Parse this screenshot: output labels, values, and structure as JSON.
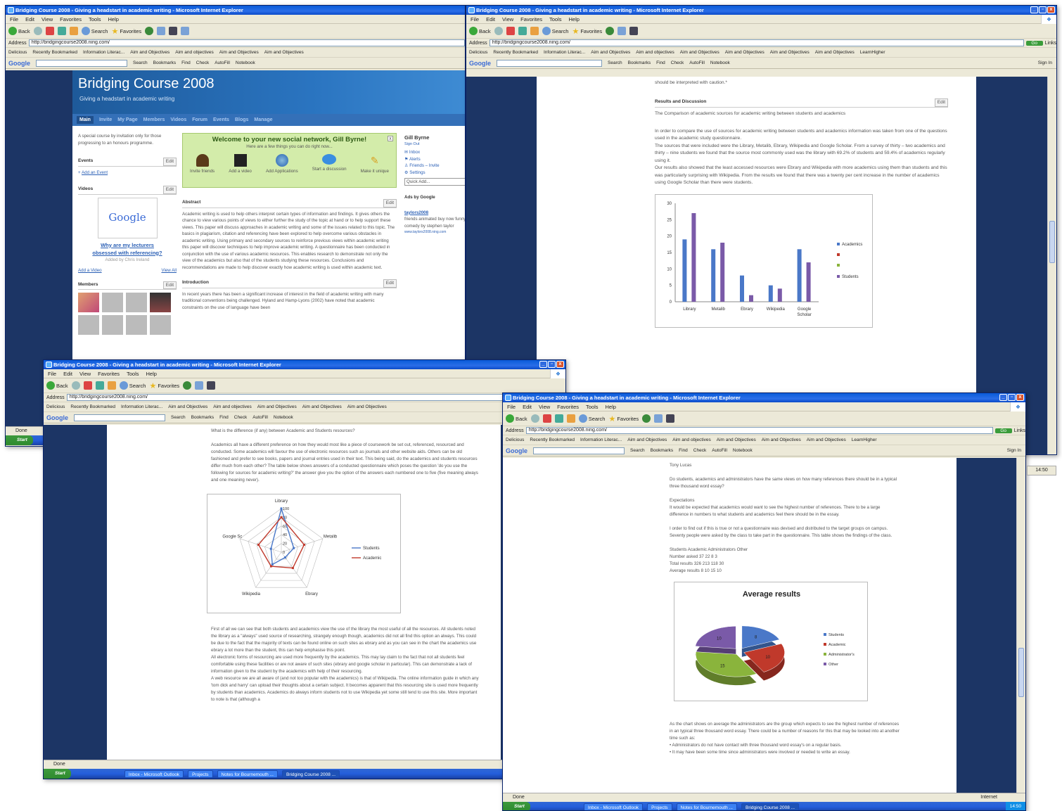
{
  "browser": {
    "title": "Bridging Course 2008 - Giving a headstart in academic writing - Microsoft Internet Explorer",
    "menu": [
      "File",
      "Edit",
      "View",
      "Favorites",
      "Tools",
      "Help"
    ],
    "toolbar": {
      "back": "Back",
      "search": "Search",
      "favorites": "Favorites"
    },
    "address_label": "Address",
    "url": "http://bridgingcourse2008.ning.com/",
    "go": "Go",
    "links": "Links",
    "bookmarks": [
      "Delicious",
      "Recently Bookmarked",
      "Information Literac...",
      "Aim and Objectives",
      "Aim and objectives",
      "Aim and Objectives",
      "Aim and Objectives",
      "Aim and Objectives",
      "Aim and Objectives",
      "LearnHigher"
    ],
    "google_bar": {
      "logo": "Google",
      "search": "Search",
      "bookmarks": "Bookmarks",
      "find": "Find",
      "check": "Check",
      "autofill": "AutoFill",
      "notebook": "Notebook",
      "sign_in": "Sign In"
    },
    "status_done": "Done",
    "status_zone": "Internet"
  },
  "taskbar": {
    "start": "Start",
    "items": [
      "Inbox - Microsoft Outlook",
      "Projects",
      "Notes for Bournemouth ...",
      "Bridging Course 2008 ..."
    ],
    "clock": "14:50"
  },
  "site": {
    "title": "Bridging Course 2008",
    "tagline": "Giving a headstart in academic writing",
    "nav": [
      "Main",
      "Invite",
      "My Page",
      "Members",
      "Videos",
      "Forum",
      "Events",
      "Blogs",
      "Manage"
    ],
    "description": "A special course by invitation only for those progressing to an honours programme.",
    "events_label": "Events",
    "add_event": "Add an Event",
    "videos_label": "Videos",
    "video_title": "Why are my lecturers obsessed with referencing?",
    "video_added_by": "Added by Chris Ireland",
    "add_video": "Add a Video",
    "view_all": "View All",
    "members_label": "Members",
    "edit": "Edit",
    "welcome_title": "Welcome to your new social network, Gill Byrne!",
    "welcome_sub": "Here are a few things you can do right now...",
    "welcome_actions": [
      "Invite friends",
      "Add a video",
      "Add Applications",
      "Start a discussion",
      "Make it unique"
    ],
    "abstract_label": "Abstract",
    "abstract_text": "Academic writing is used to help others interpret certain types of information and findings. It gives others the chance to view various points of views to either further the study of the topic at hand or to help support these views. This paper will discuss approaches in academic writing and some of the issues related to this topic. The basics in plagiarism, citation and referencing have been explored to help overcome various obstacles in academic writing. Using primary and secondary sources to reinforce previous views within academic writing this paper will discover techniques to help improve academic writing. A questionnaire has been conducted in conjunction with the use of various academic resources. This enables research to demonstrate not only the view of the academics but also that of the students studying these resources. Conclusions and recommendations are made to help discover exactly how academic writing is used within academic text.",
    "intro_label": "Introduction",
    "intro_text": "In recent years there has been a significant increase of interest in the field of academic writing with many traditional conventions being challenged. Hyland and Hamp-Lyons (2002) have noted that academic constraints on the use of language have been",
    "user_name": "Gill Byrne",
    "sign_out": "Sign Out",
    "user_links": [
      "Inbox",
      "Alerts",
      "Friends – Invite",
      "Settings"
    ],
    "quick_add": "Quick Add...",
    "ads_by": "Ads by Google",
    "ad_title": "taylors2008",
    "ad_text": "friends animated buy now funny comedy by stephen taylor",
    "ad_url": "www.taylors2008.ning.com"
  },
  "doc2": {
    "caution": "should be interpreted with caution.*",
    "section": "Results and Discussion",
    "p1": "The Comparison of academic sources for academic writing between students and academics",
    "p2": "In order to compare the use of sources for academic writing between students and academics information was taken from one of the questions used in the academic study questionnaire.",
    "p3": "The sources that were included were the Library, Metalib, Ebrary, Wikipedia and Google Scholar. From a survey of thirty – two academics and thirty – nine students we found that the source most commonly used was the library with 69.2% of students and 59.4% of academics regularly using it.",
    "p4": "Our results also showed that the least accessed resources were Ebrary and Wikipedia with more academics using them than students and this was particularly surprising with Wikipedia. From the results we found that there was a twenty per cent increase in the number of academics using Google Scholar than there were students."
  },
  "doc3": {
    "question": "What is the difference (if any) between Academic and Students resources?",
    "p1": "Academics all have a different preference on how they would most like a piece of coursework be set out, referenced, resourced and conducted. Some academics will favour the use of electronic resources such as journals and other website aids. Others can be old fashioned and prefer to see books, papers and journal entries used in their text. This being said, do the academics and students resources differ much from each other? The table below shows answers of a conducted questionnaire which poses the question 'do you use the following for sources for academic writing?' the answer give you the option of the answers each numbered one to five (five meaning always and one meaning never).",
    "p2": "First of all we can see that both students and academics view the use of the library the most useful of all the resources. All students noted the library as a \"always\" used source of researching, strangely enough though, academics did not all find this option an always. This could be due to the fact that the majority of texts can be found online on such sites as ebrary and as you can see in the chart the academics use ebrary a lot more than the student, this can help emphasise this point.",
    "p3": "All electronic forms of resourcing are used more frequently by the academics. This may lay claim to the fact that not all students feel comfortable using these facilities or are not aware of such sites (ebrary and google scholar in particular). This can demonstrate a lack of information given to the student by the academics with help of their resourcing.",
    "p4": "A web resource we are all aware of (and not too popular with the academics) is that of Wikipedia. The online information guide in which any 'tom dick and harry' can upload their thoughts about a certain subject. It becomes apparent that this resourcing site is used more frequently by students than academics. Academics do always inform students not to use Wikipedia yet some still tend to use this site. More important to note is that (although a"
  },
  "doc4": {
    "author": "Tony Lucas",
    "question": "Do students, academics and administrators have the same views on how many references there should be in a typical three thousand word essay?",
    "exp_label": "Expectations",
    "exp_text": "It would be expected that academics would want to see the highest number of references. There to be a large difference in numbers to what students and academics feel there should be in the essay.",
    "method": "I order to find out if this is true or not a questionnaire was devised and distributed to the target groups on campus. Seventy people were asked by the class to take part in the questionnaire. This table shows the findings of the class.",
    "table": [
      "Students Academic Administrators Other",
      "Number asked 37 22 8 3",
      "Total results 326 213 118 30",
      "Average results 8 10 15 10"
    ],
    "after1": "As the chart shows on average the administrators are the group which expects to see the highest number of references in an typical three thousand word essay. There could be a number of reasons for this that may be looked into at another time such as:",
    "after2": "• Administrators do not have contact with three thousand word essay's on a regular basis.",
    "after3": "• It may have been some time since administrators were involved or needed to write an essay."
  },
  "chart_data": [
    {
      "type": "bar",
      "categories": [
        "Library",
        "Metalib",
        "Ebrary",
        "Wikipedia",
        "Google Scholar"
      ],
      "series": [
        {
          "name": "Academics",
          "values": [
            19,
            16,
            8,
            5,
            16
          ],
          "color": "#4a78c8"
        },
        {
          "name": "Students",
          "values": [
            27,
            18,
            2,
            4,
            12
          ],
          "color": "#7a5aa8"
        }
      ],
      "ylim": [
        0,
        30
      ],
      "yticks": [
        0,
        5,
        10,
        15,
        20,
        25,
        30
      ],
      "legend_position": "right"
    },
    {
      "type": "radar",
      "axes": [
        "Library",
        "Metalib",
        "Ebrary",
        "Wikipedia",
        "Google Sc"
      ],
      "rticks": [
        0,
        20,
        40,
        60,
        80,
        100
      ],
      "series": [
        {
          "name": "Students",
          "values": [
            100,
            30,
            15,
            35,
            25
          ],
          "color": "#4a78c8"
        },
        {
          "name": "Academic",
          "values": [
            80,
            55,
            45,
            40,
            55
          ],
          "color": "#c0392b"
        }
      ],
      "legend_position": "right"
    },
    {
      "type": "pie",
      "title": "Average results",
      "labels": [
        "Students",
        "Academic",
        "Administrator's",
        "Other"
      ],
      "values": [
        8,
        10,
        15,
        10
      ],
      "colors": [
        "#4a78c8",
        "#c0392b",
        "#8ab43c",
        "#7a5aa8"
      ],
      "legend_position": "right"
    }
  ]
}
